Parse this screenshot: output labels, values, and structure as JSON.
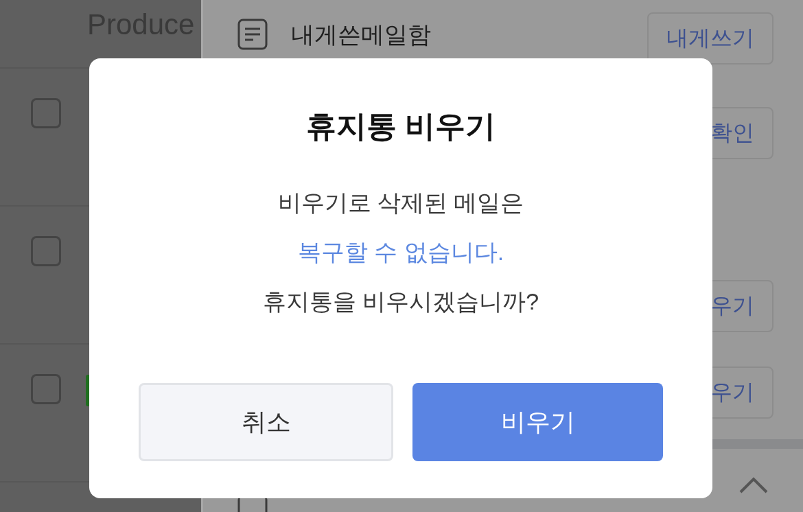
{
  "list": {
    "header": "Produce",
    "rows": [
      {
        "kind": "plain",
        "checked": false
      },
      {
        "kind": "plain",
        "checked": false
      },
      {
        "kind": "tagged",
        "checked": false
      }
    ]
  },
  "panel": {
    "title": "내게쓴메일함",
    "buttons": [
      {
        "label": "내게쓰기"
      },
      {
        "label": "확인"
      },
      {
        "label": "우기"
      },
      {
        "label": "우기"
      }
    ]
  },
  "dialog": {
    "title": "휴지통 비우기",
    "lines": [
      {
        "text": "비우기로 삭제된 메일은",
        "emphasis": false
      },
      {
        "text": "복구할 수 없습니다.",
        "emphasis": true
      },
      {
        "text": "휴지통을 비우시겠습니까?",
        "emphasis": false
      }
    ],
    "buttons": [
      {
        "kind": "cancel",
        "label": "취소"
      },
      {
        "kind": "confirm",
        "label": "비우기"
      }
    ]
  }
}
